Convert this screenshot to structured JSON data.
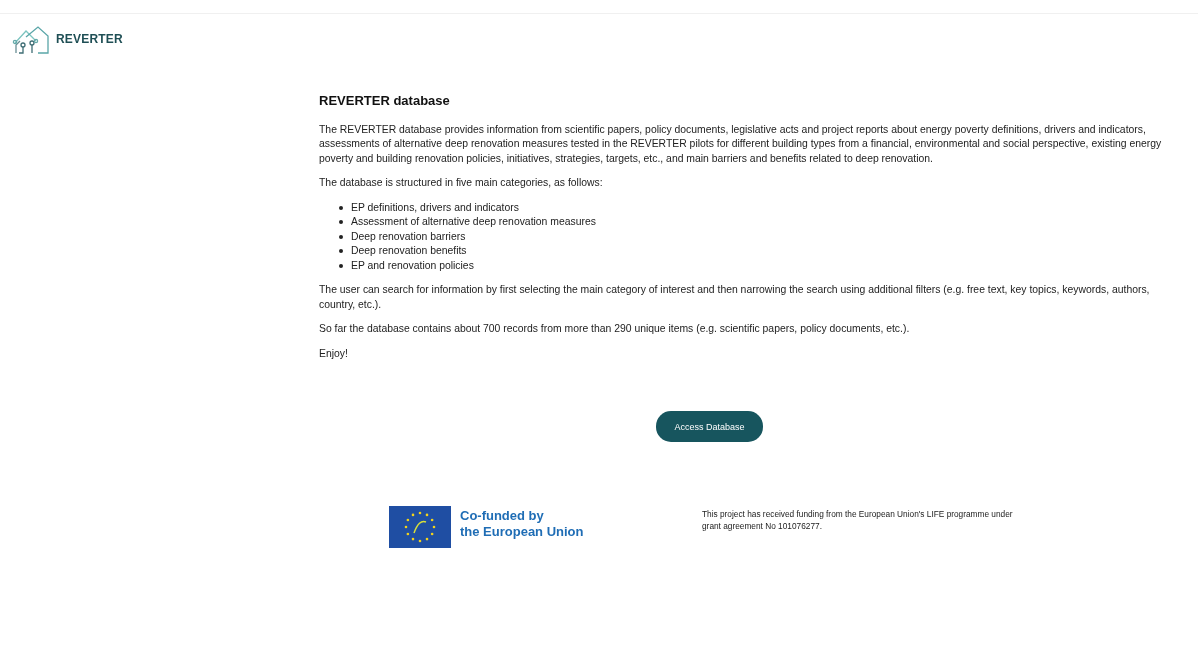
{
  "header": {
    "brand": "REVERTER"
  },
  "content": {
    "title": "REVERTER database",
    "intro": "The REVERTER database provides information from scientific papers, policy documents, legislative acts and project reports about energy poverty definitions, drivers and indicators, assessments of alternative deep renovation measures tested in the REVERTER pilots for different building types from a financial, environmental and social perspective, existing energy poverty and building renovation policies, initiatives, strategies, targets, etc., and main barriers and benefits related to deep renovation.",
    "structure_lead": "The database is structured in five main categories, as follows:",
    "categories": [
      "EP definitions, drivers and indicators",
      "Assessment of alternative deep renovation measures",
      "Deep renovation barriers",
      "Deep renovation benefits",
      "EP and renovation policies"
    ],
    "paragraphs": [
      "The user can search for information by first selecting the main category of interest and then narrowing the search using additional filters (e.g. free text, key topics, keywords, authors, country, etc.).",
      "So far the database contains about 700 records from more than 290 unique items (e.g. scientific papers, policy documents, etc.).",
      "Enjoy!"
    ],
    "button": "Access Database"
  },
  "footer": {
    "cofunded": [
      "Co-funded by",
      "the European Union"
    ],
    "funding_note": "This project has received funding from the European Union's LIFE programme under grant agreement No 101076277."
  }
}
